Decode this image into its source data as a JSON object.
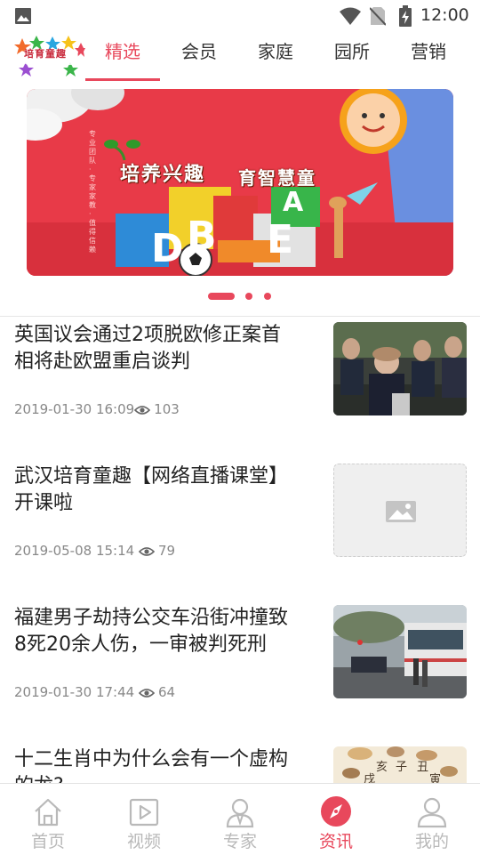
{
  "status_bar": {
    "time": "12:00"
  },
  "app": {
    "logo_text": "培育童趣"
  },
  "top_tabs": [
    {
      "label": "精选",
      "active": true
    },
    {
      "label": "会员",
      "active": false
    },
    {
      "label": "家庭",
      "active": false
    },
    {
      "label": "园所",
      "active": false
    },
    {
      "label": "营销",
      "active": false
    }
  ],
  "banner": {
    "headline_left": "培养兴趣",
    "headline_right": "育智慧童",
    "side_text": "专业团队·专家家教·值得信赖",
    "block_letters": [
      "D",
      "B",
      "E",
      "A"
    ],
    "slide_count": 3,
    "active_slide": 1
  },
  "news": [
    {
      "title": "英国议会通过2项脱欧修正案首相将赴欧盟重启谈判",
      "date": "2019-01-30 16:09",
      "views": "103",
      "thumb": "parliament"
    },
    {
      "title": "武汉培育童趣【网络直播课堂】开课啦",
      "date": "2019-05-08 15:14",
      "views": "79",
      "thumb": "placeholder"
    },
    {
      "title": "福建男子劫持公交车沿街冲撞致8死20余人伤，一审被判死刑",
      "date": "2019-01-30 17:44",
      "views": "64",
      "thumb": "bus"
    },
    {
      "title": "十二生肖中为什么会有一个虚构的龙?",
      "date": "",
      "views": "",
      "thumb": "zodiac"
    }
  ],
  "zodiac_chars": [
    "亥",
    "子",
    "丑",
    "戌",
    "寅"
  ],
  "bottom_nav": [
    {
      "label": "首页",
      "icon": "home-icon",
      "active": false
    },
    {
      "label": "视频",
      "icon": "video-icon",
      "active": false
    },
    {
      "label": "专家",
      "icon": "expert-icon",
      "active": false
    },
    {
      "label": "资讯",
      "icon": "compass-icon",
      "active": true
    },
    {
      "label": "我的",
      "icon": "profile-icon",
      "active": false
    }
  ],
  "colors": {
    "accent": "#e8485c",
    "inactive": "#b9b9b9",
    "meta_text": "#888888"
  }
}
